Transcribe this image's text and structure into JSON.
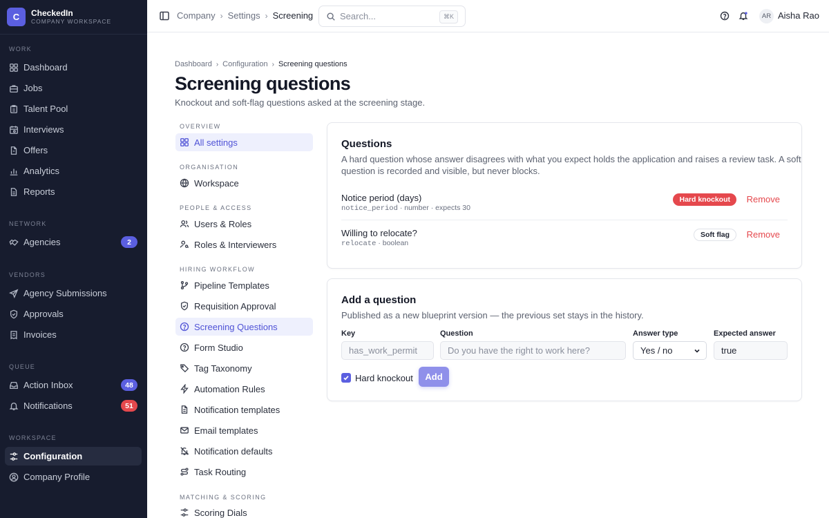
{
  "brand": {
    "logo_letter": "C",
    "name": "CheckedIn",
    "subtitle": "COMPANY WORKSPACE"
  },
  "sidebar": {
    "sections": [
      {
        "title": "WORK",
        "items": [
          {
            "label": "Dashboard",
            "icon": "grid-icon"
          },
          {
            "label": "Jobs",
            "icon": "briefcase-icon"
          },
          {
            "label": "Talent Pool",
            "icon": "clipboard-icon"
          },
          {
            "label": "Interviews",
            "icon": "calendar-icon"
          },
          {
            "label": "Offers",
            "icon": "file-icon"
          },
          {
            "label": "Analytics",
            "icon": "bar-chart-icon"
          },
          {
            "label": "Reports",
            "icon": "report-icon"
          }
        ]
      },
      {
        "title": "NETWORK",
        "items": [
          {
            "label": "Agencies",
            "icon": "handshake-icon",
            "badge": "2"
          }
        ]
      },
      {
        "title": "VENDORS",
        "items": [
          {
            "label": "Agency Submissions",
            "icon": "send-icon"
          },
          {
            "label": "Approvals",
            "icon": "shield-check-icon"
          },
          {
            "label": "Invoices",
            "icon": "receipt-icon"
          }
        ]
      },
      {
        "title": "QUEUE",
        "items": [
          {
            "label": "Action Inbox",
            "icon": "inbox-icon",
            "badge": "48"
          },
          {
            "label": "Notifications",
            "icon": "bell-icon",
            "badge": "51"
          }
        ]
      },
      {
        "title": "WORKSPACE",
        "items": [
          {
            "label": "Configuration",
            "icon": "sliders-icon",
            "active": true
          },
          {
            "label": "Company Profile",
            "icon": "user-circle-icon"
          }
        ]
      }
    ]
  },
  "topbar": {
    "breadcrumbs": [
      "Company",
      "Settings",
      "Screening"
    ],
    "search_placeholder": "Search...",
    "search_shortcut": "⌘K",
    "user_initials": "AR",
    "user_name": "Aisha Rao"
  },
  "page": {
    "breadcrumbs": [
      "Dashboard",
      "Configuration",
      "Screening questions"
    ],
    "title": "Screening questions",
    "subtitle": "Knockout and soft-flag questions asked at the screening stage."
  },
  "settings_nav": {
    "sections": [
      {
        "title": "OVERVIEW",
        "items": [
          {
            "label": "All settings",
            "icon": "grid-icon",
            "active": true
          }
        ]
      },
      {
        "title": "ORGANISATION",
        "items": [
          {
            "label": "Workspace",
            "icon": "globe-icon"
          }
        ]
      },
      {
        "title": "PEOPLE & ACCESS",
        "items": [
          {
            "label": "Users & Roles",
            "icon": "users-icon"
          },
          {
            "label": "Roles & Interviewers",
            "icon": "user-key-icon"
          }
        ]
      },
      {
        "title": "HIRING WORKFLOW",
        "items": [
          {
            "label": "Pipeline Templates",
            "icon": "git-branch-icon"
          },
          {
            "label": "Requisition Approval",
            "icon": "shield-check-icon"
          },
          {
            "label": "Screening Questions",
            "icon": "help-circle-icon",
            "active": true
          },
          {
            "label": "Form Studio",
            "icon": "help-circle-icon"
          },
          {
            "label": "Tag Taxonomy",
            "icon": "tag-icon"
          },
          {
            "label": "Automation Rules",
            "icon": "lightning-icon"
          },
          {
            "label": "Notification templates",
            "icon": "file-text-icon"
          },
          {
            "label": "Email templates",
            "icon": "mail-icon"
          },
          {
            "label": "Notification defaults",
            "icon": "bell-off-icon"
          },
          {
            "label": "Task Routing",
            "icon": "route-icon"
          }
        ]
      },
      {
        "title": "MATCHING & SCORING",
        "items": [
          {
            "label": "Scoring Dials",
            "icon": "sliders-icon"
          }
        ]
      }
    ]
  },
  "questions_card": {
    "title": "Questions",
    "description_line1": "A hard question whose answer disagrees with what you expect holds the application and raises a review task. A soft",
    "description_line2": "question is recorded and visible, but never blocks.",
    "questions": [
      {
        "label": "Notice period (days)",
        "key": "notice_period",
        "meta": " · number · expects 30",
        "pill": "Hard knockout",
        "pill_type": "hard",
        "remove": "Remove"
      },
      {
        "label": "Willing to relocate?",
        "key": "relocate",
        "meta": " · boolean",
        "pill": "Soft flag",
        "pill_type": "soft",
        "remove": "Remove"
      }
    ]
  },
  "add_card": {
    "title": "Add a question",
    "description": "Published as a new blueprint version — the previous set stays in the history.",
    "key_label": "Key",
    "key_placeholder": "has_work_permit",
    "question_label": "Question",
    "question_placeholder": "Do you have the right to work here?",
    "answer_type_label": "Answer type",
    "answer_type_value": "Yes / no",
    "expected_label": "Expected answer",
    "expected_value": "true",
    "hard_knockout_label": "Hard knockout",
    "hard_knockout_checked": true,
    "add_button": "Add"
  },
  "colors": {
    "accent": "#5b5fe0",
    "danger": "#e5484d",
    "sidebar_bg": "#171c2e"
  }
}
